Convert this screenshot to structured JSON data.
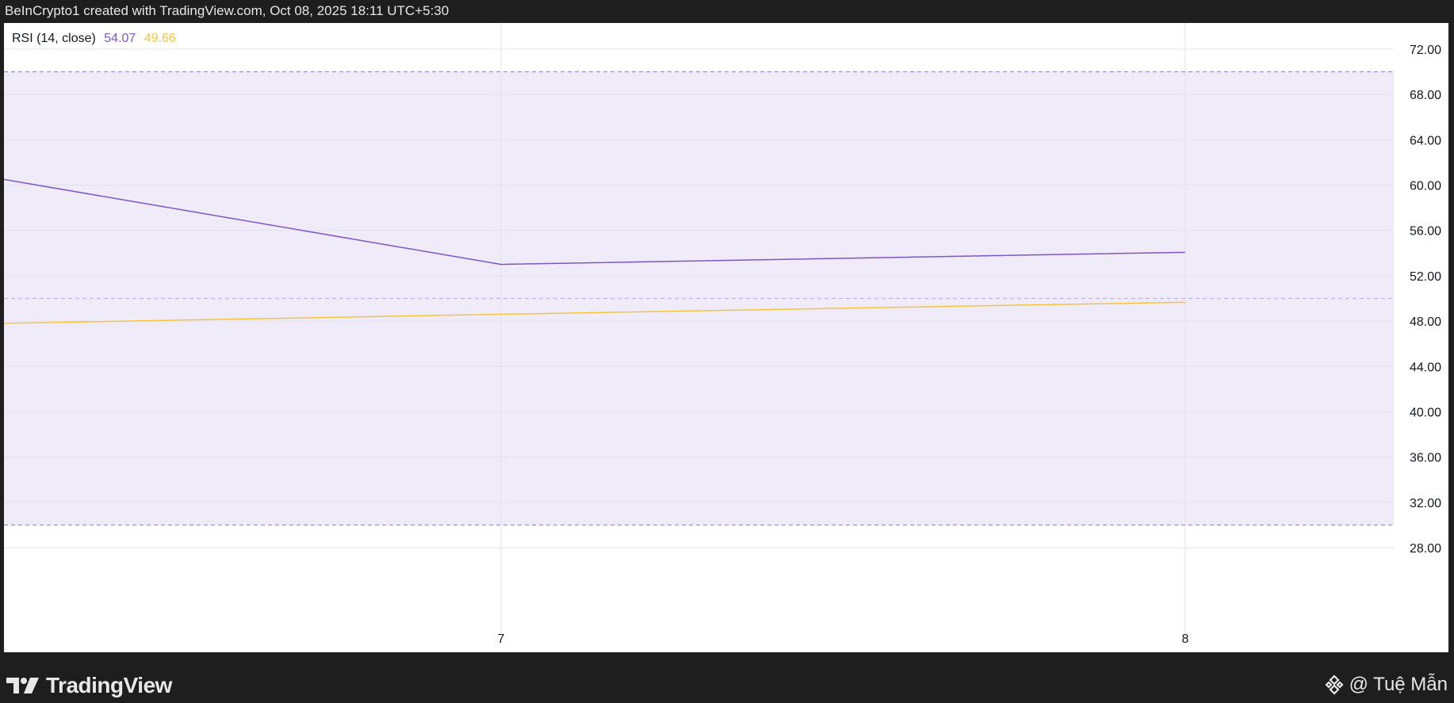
{
  "header": {
    "attribution": "BeInCrypto1 created with TradingView.com, Oct 08, 2025 18:11 UTC+5:30"
  },
  "legend": {
    "indicator": "RSI (14, close)",
    "rsi_value": "54.07",
    "ma_value": "49.66"
  },
  "footer": {
    "brand": "TradingView",
    "credit": "@ Tuệ Mẫn"
  },
  "colors": {
    "rsi_line": "#7e57c2",
    "ma_line": "#f5c542",
    "band_fill": "#efebf8",
    "band_border": "#8e7cc3"
  },
  "chart_data": {
    "type": "line",
    "x": [
      "6",
      "7",
      "8"
    ],
    "x_tick_labels": [
      "7",
      "8"
    ],
    "ylim": [
      26,
      74
    ],
    "y_ticks": [
      "72.00",
      "68.00",
      "64.00",
      "60.00",
      "56.00",
      "52.00",
      "48.00",
      "44.00",
      "40.00",
      "36.00",
      "32.00",
      "28.00"
    ],
    "bands": {
      "upper": 70,
      "middle": 50,
      "lower": 30
    },
    "series": [
      {
        "name": "RSI (14, close)",
        "values": [
          60.5,
          53.0,
          54.07
        ]
      },
      {
        "values": [
          47.8,
          48.6,
          49.66
        ]
      }
    ],
    "grid": true
  }
}
